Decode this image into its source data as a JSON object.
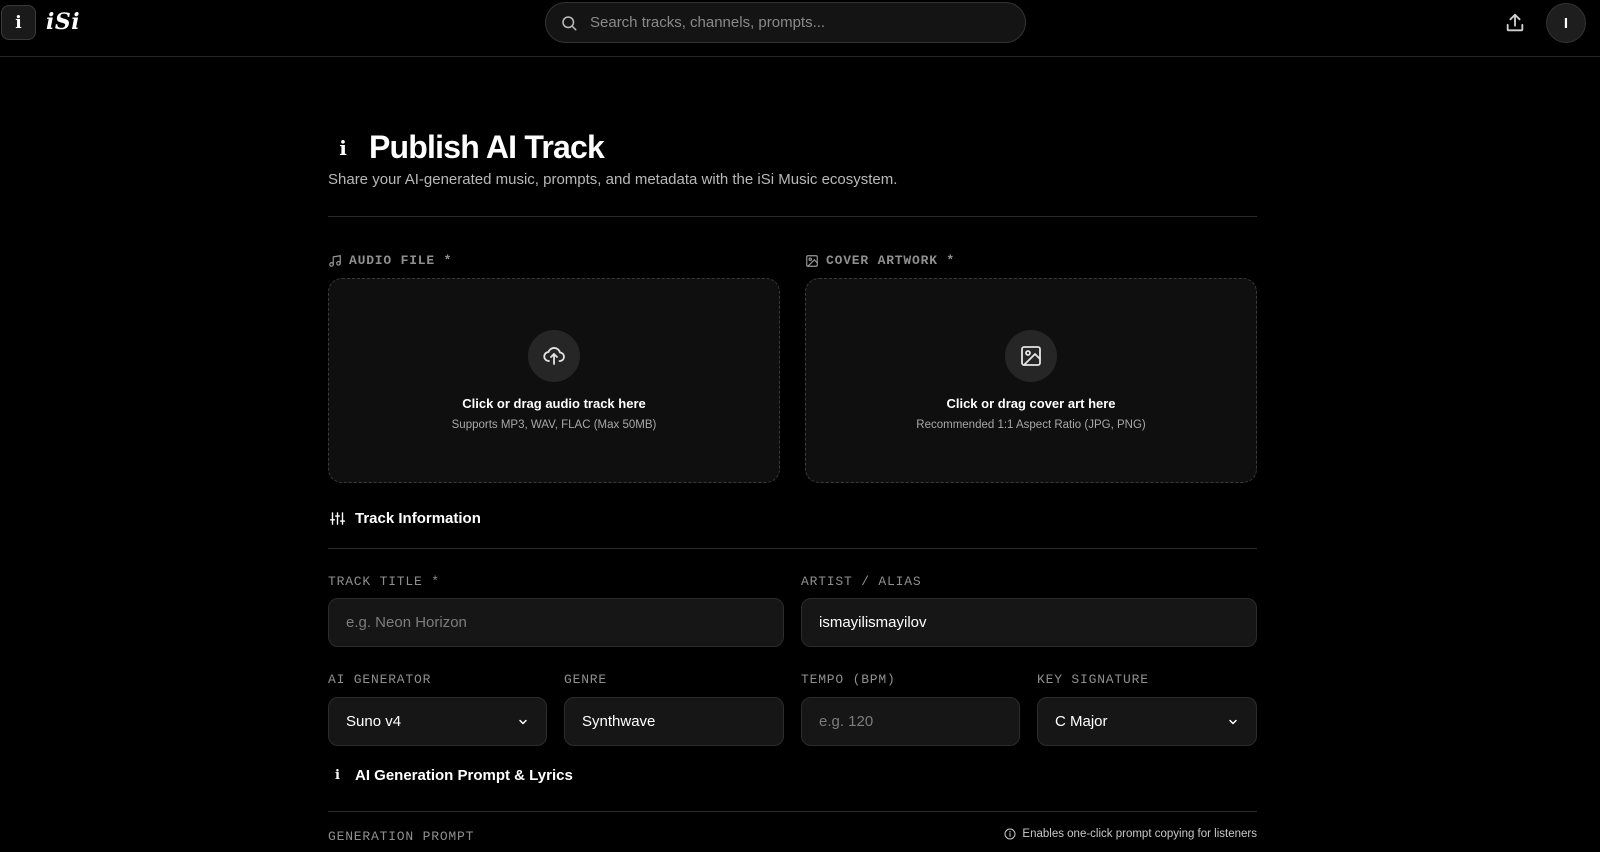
{
  "header": {
    "logo_glyph": "i",
    "logo_text": "iSi",
    "search_placeholder": "Search tracks, channels, prompts...",
    "avatar_initial": "I"
  },
  "page": {
    "title_glyph": "i",
    "title": "Publish AI Track",
    "subtitle": "Share your AI-generated music, prompts, and metadata with the iSi Music ecosystem."
  },
  "uploads": {
    "audio": {
      "label": "AUDIO FILE *",
      "title": "Click or drag audio track here",
      "subtitle": "Supports MP3, WAV, FLAC (Max 50MB)"
    },
    "cover": {
      "label": "COVER ARTWORK *",
      "title": "Click or drag cover art here",
      "subtitle": "Recommended 1:1 Aspect Ratio (JPG, PNG)"
    }
  },
  "track_info": {
    "heading": "Track Information",
    "title_label": "TRACK TITLE *",
    "title_placeholder": "e.g. Neon Horizon",
    "artist_label": "ARTIST / ALIAS",
    "artist_value": "ismayilismayilov",
    "generator_label": "AI GENERATOR",
    "generator_value": "Suno v4",
    "genre_label": "GENRE",
    "genre_value": "Synthwave",
    "tempo_label": "TEMPO (BPM)",
    "tempo_placeholder": "e.g. 120",
    "key_label": "KEY SIGNATURE",
    "key_value": "C Major"
  },
  "prompt_section": {
    "heading_glyph": "i",
    "heading": "AI Generation Prompt & Lyrics",
    "prompt_label": "GENERATION PROMPT",
    "hint": "Enables one-click prompt copying for listeners"
  }
}
